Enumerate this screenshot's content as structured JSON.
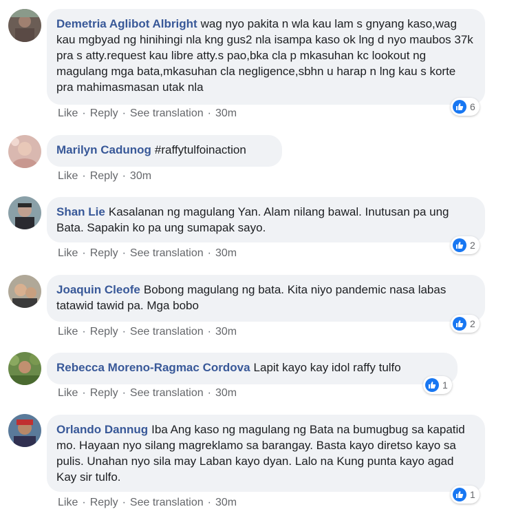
{
  "comments": [
    {
      "author": "Demetria Aglibot Albright",
      "text": "wag nyo pakita n wla kau lam s gnyang kaso,wag kau mgbyad ng hinihingi nla kng gus2 nla isampa kaso ok lng d nyo maubos 37k pra s atty.request kau libre atty.s pao,bka cla p mkasuhan kc lookout ng magulang mga bata,mkasuhan cla negligence,sbhn u harap n lng kau s korte pra mahimasmasan utak nla",
      "like": "Like",
      "reply": "Reply",
      "translate": "See translation",
      "time": "30m",
      "reactions": "6"
    },
    {
      "author": "Marilyn Cadunog",
      "text": "#raffytulfoinaction",
      "like": "Like",
      "reply": "Reply",
      "time": "30m"
    },
    {
      "author": "Shan Lie",
      "text": "Kasalanan ng magulang Yan. Alam nilang bawal. Inutusan pa ung Bata. Sapakin ko pa ung sumapak sayo.",
      "like": "Like",
      "reply": "Reply",
      "translate": "See translation",
      "time": "30m",
      "reactions": "2"
    },
    {
      "author": "Joaquin Cleofe",
      "text": "Bobong magulang ng bata. Kita niyo pandemic nasa labas tatawid tawid pa. Mga bobo",
      "like": "Like",
      "reply": "Reply",
      "translate": "See translation",
      "time": "30m",
      "reactions": "2"
    },
    {
      "author": "Rebecca Moreno-Ragmac Cordova",
      "text": "Lapit kayo kay idol raffy tulfo",
      "like": "Like",
      "reply": "Reply",
      "translate": "See translation",
      "time": "30m",
      "reactions": "1"
    },
    {
      "author": "Orlando Dannug",
      "text": "Iba Ang kaso ng magulang ng Bata na bumugbug sa kapatid mo. Hayaan nyo silang magreklamo sa barangay. Basta kayo diretso kayo sa pulis. Unahan nyo sila may Laban kayo dyan. Lalo na Kung punta kayo agad Kay sir tulfo.",
      "like": "Like",
      "reply": "Reply",
      "translate": "See translation",
      "time": "30m",
      "reactions": "1"
    }
  ],
  "colors": {
    "name": "#385898",
    "bubble": "#f0f2f5",
    "like_blue": "#1877f2",
    "meta": "#606770"
  },
  "icons": {
    "reaction": "thumbs-up-icon",
    "dot_separator": "·"
  }
}
